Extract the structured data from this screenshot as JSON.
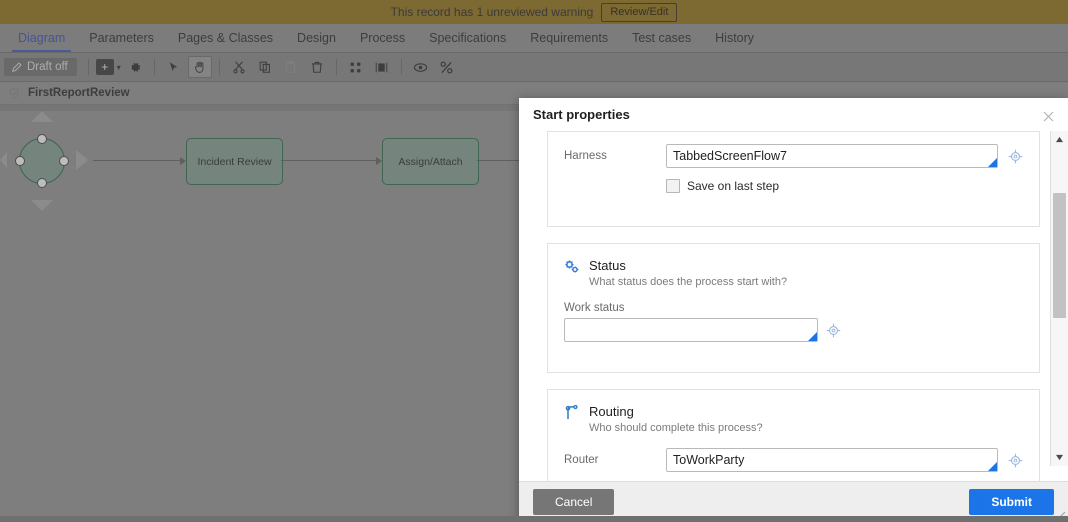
{
  "warning": {
    "text": "This record has 1 unreviewed warning",
    "button_label": "Review/Edit"
  },
  "tabs": [
    {
      "label": "Diagram",
      "active": true
    },
    {
      "label": "Parameters",
      "active": false
    },
    {
      "label": "Pages & Classes",
      "active": false
    },
    {
      "label": "Design",
      "active": false
    },
    {
      "label": "Process",
      "active": false
    },
    {
      "label": "Specifications",
      "active": false
    },
    {
      "label": "Requirements",
      "active": false
    },
    {
      "label": "Test cases",
      "active": false
    },
    {
      "label": "History",
      "active": false
    }
  ],
  "toolbar": {
    "draft_label": "Draft off",
    "icons": [
      "pencil-icon",
      "add-shape-icon",
      "chevron-down-icon",
      "gear-icon",
      "pointer-icon",
      "hand-icon",
      "cut-icon",
      "copy-icon",
      "paste-icon",
      "delete-icon",
      "align-icon",
      "distribute-icon",
      "preview-icon",
      "percent-icon"
    ]
  },
  "breadcrumb": {
    "icon": "shield-icon",
    "label": "FirstReportReview"
  },
  "diagram": {
    "start_node_label": "",
    "nodes": [
      {
        "label": "Incident Review"
      },
      {
        "label": "Assign/Attach"
      }
    ]
  },
  "dialog": {
    "title": "Start properties",
    "close_icon": "close-icon",
    "harness": {
      "label": "Harness",
      "value": "TabbedScreenFlow7",
      "picker_icon": "crosshair-icon"
    },
    "save_on_last_step": {
      "label": "Save on last step",
      "checked": false
    },
    "status_section": {
      "icon": "gears-icon",
      "title": "Status",
      "subtitle": "What status does the process start with?",
      "field_label": "Work status",
      "field_value": "",
      "picker_icon": "crosshair-icon"
    },
    "routing_section": {
      "icon": "routing-icon",
      "title": "Routing",
      "subtitle": "Who should complete this process?",
      "field_label": "Router",
      "field_value": "ToWorkParty",
      "picker_icon": "crosshair-icon"
    },
    "footer": {
      "cancel_label": "Cancel",
      "submit_label": "Submit"
    }
  },
  "colors": {
    "banner": "#8a6d1f",
    "accent_blue": "#1b74e8",
    "tab_active": "#4356b0",
    "node_green": "#2f6b4b",
    "canvas": "#8b8b8b"
  }
}
